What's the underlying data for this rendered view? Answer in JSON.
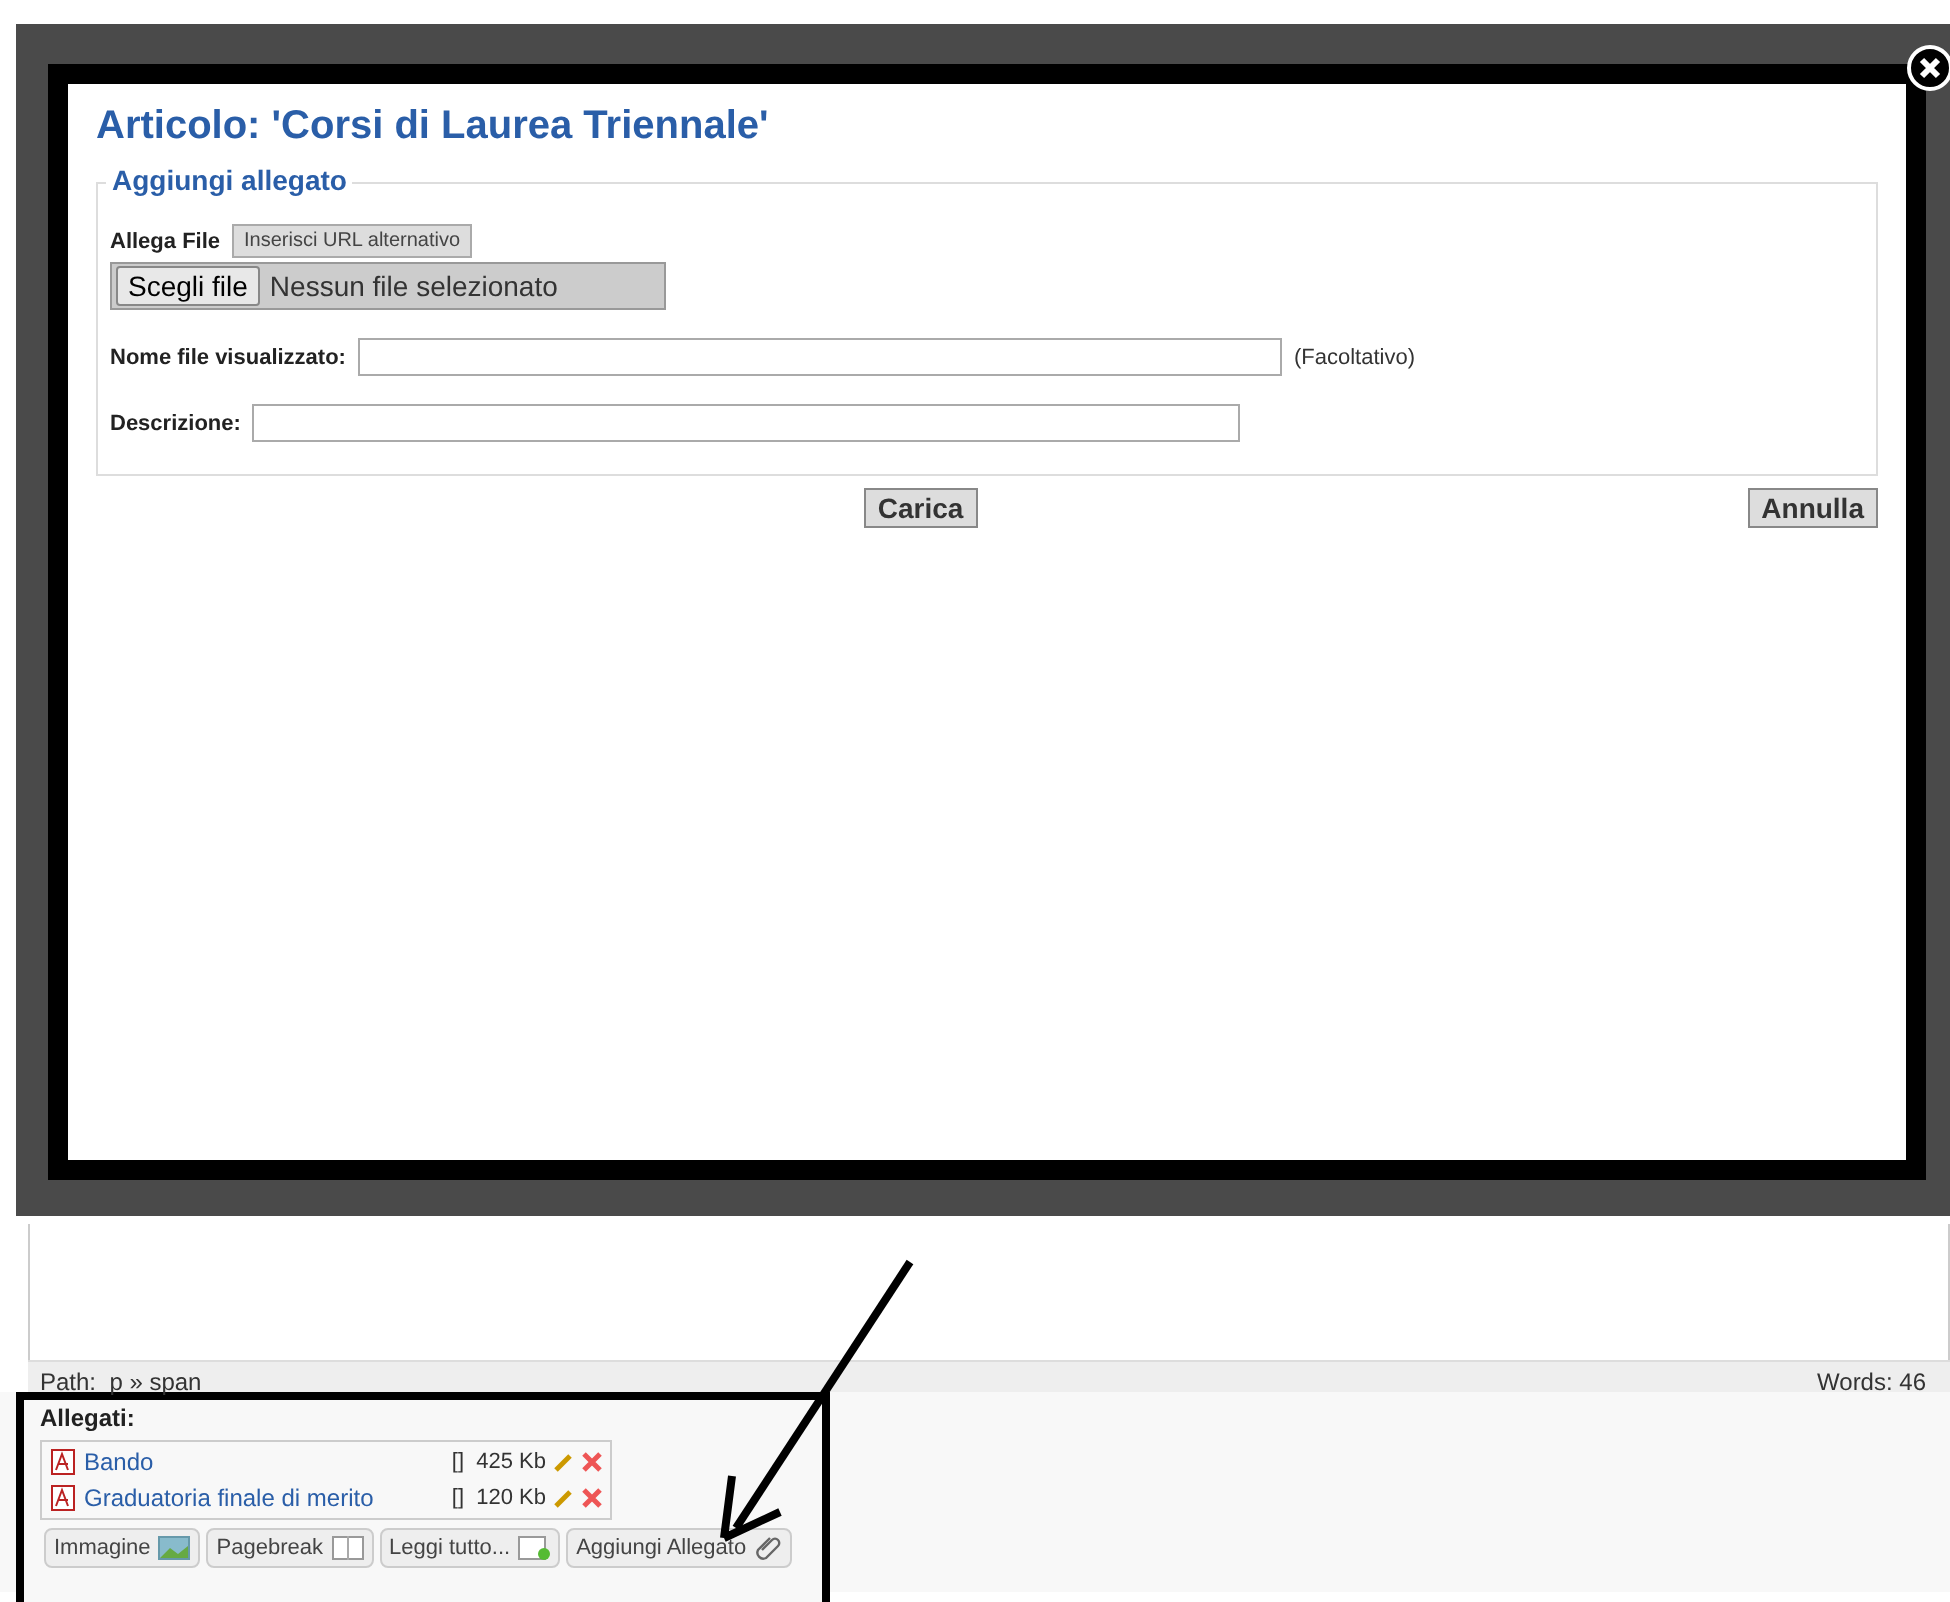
{
  "dialog": {
    "title": "Articolo: 'Corsi di Laurea Triennale'",
    "section": "Aggiungi allegato",
    "attach_label": "Allega File",
    "alt_url_button": "Inserisci URL alternativo",
    "file_button": "Scegli file",
    "file_status": "Nessun file selezionato",
    "fields": [
      {
        "label": "Nome file visualizzato:",
        "note": "(Facoltativo)"
      },
      {
        "label": "Descrizione:"
      }
    ],
    "upload_button": "Carica",
    "cancel_button": "Annulla"
  },
  "editor": {
    "path": "Path:  p » span",
    "words": "Words: 46"
  },
  "attachments": {
    "title": "Allegati:",
    "files": [
      {
        "name": "Bando",
        "brackets": "[]",
        "size": "425 Kb"
      },
      {
        "name": "Graduatoria finale di merito",
        "brackets": "[]",
        "size": "120 Kb"
      }
    ],
    "buttons": [
      {
        "label": "Immagine",
        "kind": "image"
      },
      {
        "label": "Pagebreak",
        "kind": "pagebreak"
      },
      {
        "label": "Leggi tutto...",
        "kind": "readmore"
      },
      {
        "label": "Aggiungi Allegato",
        "kind": "attachment"
      }
    ]
  }
}
